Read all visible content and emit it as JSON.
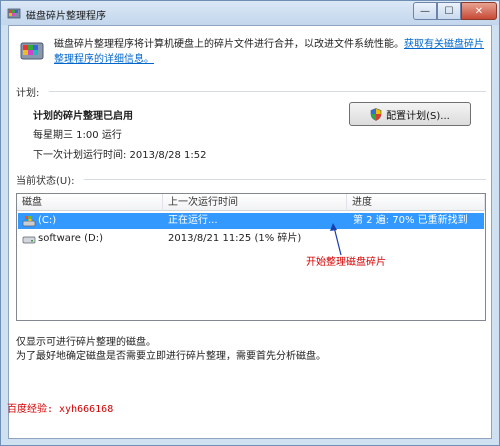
{
  "window": {
    "title": "磁盘碎片整理程序",
    "min_glyph": "—",
    "max_glyph": "☐",
    "close_glyph": "✕"
  },
  "intro": {
    "text": "磁盘碎片整理程序将计算机硬盘上的碎片文件进行合并，以改进文件系统性能。",
    "link": "获取有关磁盘碎片整理程序的详细信息。"
  },
  "schedule": {
    "section_title": "计划:",
    "status": "计划的碎片整理已启用",
    "run_time": "每星期三  1:00 运行",
    "next_run": "下一次计划运行时间: 2013/8/28 1:52",
    "configure_button": "配置计划(S)..."
  },
  "current_status": {
    "section_title": "当前状态(U):",
    "columns": [
      "磁盘",
      "上一次运行时间",
      "进度"
    ],
    "rows": [
      {
        "disk": "(C:)",
        "last_run": "正在运行...",
        "progress": "第 2 遍: 70% 已重新找到"
      },
      {
        "disk": "software (D:)",
        "last_run": "2013/8/21 11:25 (1% 碎片)",
        "progress": ""
      }
    ]
  },
  "annotation": "开始整理磁盘碎片",
  "footer": {
    "line1": "仅显示可进行碎片整理的磁盘。",
    "line2": "为了最好地确定磁盘是否需要立即进行碎片整理，需要首先分析磁盘。"
  },
  "watermark": "百度经验: xyh666168",
  "colors": {
    "selection": "#3399ff",
    "link": "#0066cc",
    "annotation": "#d40000"
  }
}
